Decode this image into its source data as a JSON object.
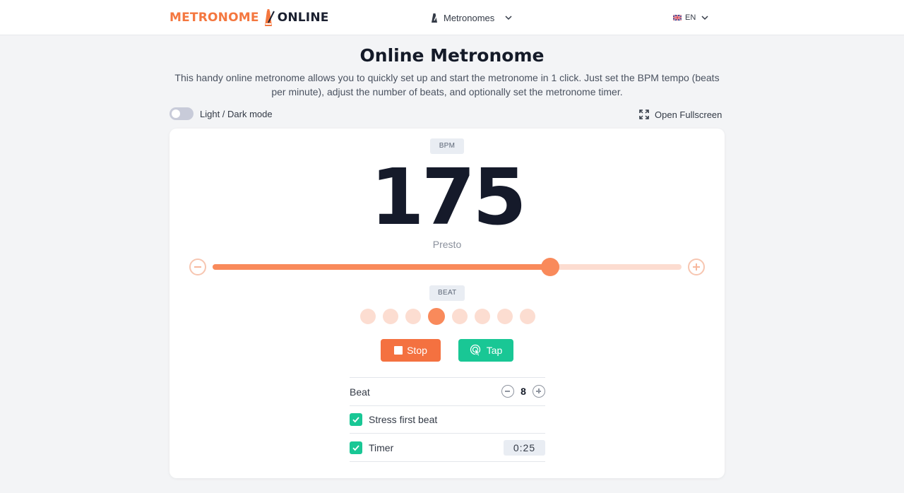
{
  "header": {
    "logo_part1": "METRONOME",
    "logo_part2": "ONLINE",
    "nav_label": "Metronomes",
    "lang_label": "EN"
  },
  "intro": {
    "title": "Online Metronome",
    "description": "This handy online metronome allows you to quickly set up and start the metronome in 1 click. Just set the BPM tempo (beats per minute), adjust the number of beats, and optionally set the metronome timer.",
    "mode_label": "Light / Dark mode",
    "fullscreen_label": "Open Fullscreen"
  },
  "metronome": {
    "bpm_chip": "BPM",
    "bpm": "175",
    "tempo_name": "Presto",
    "slider_fraction": 0.72,
    "beat_chip": "BEAT",
    "beats_total": 8,
    "active_beat": 4,
    "stop_label": "Stop",
    "tap_label": "Tap"
  },
  "settings": {
    "beat_label": "Beat",
    "beat_value": "8",
    "stress_label": "Stress first beat",
    "timer_label": "Timer",
    "timer_value": "0:25"
  },
  "colors": {
    "accent": "#f98a5b",
    "stop": "#f47140",
    "tap": "#19c795"
  }
}
